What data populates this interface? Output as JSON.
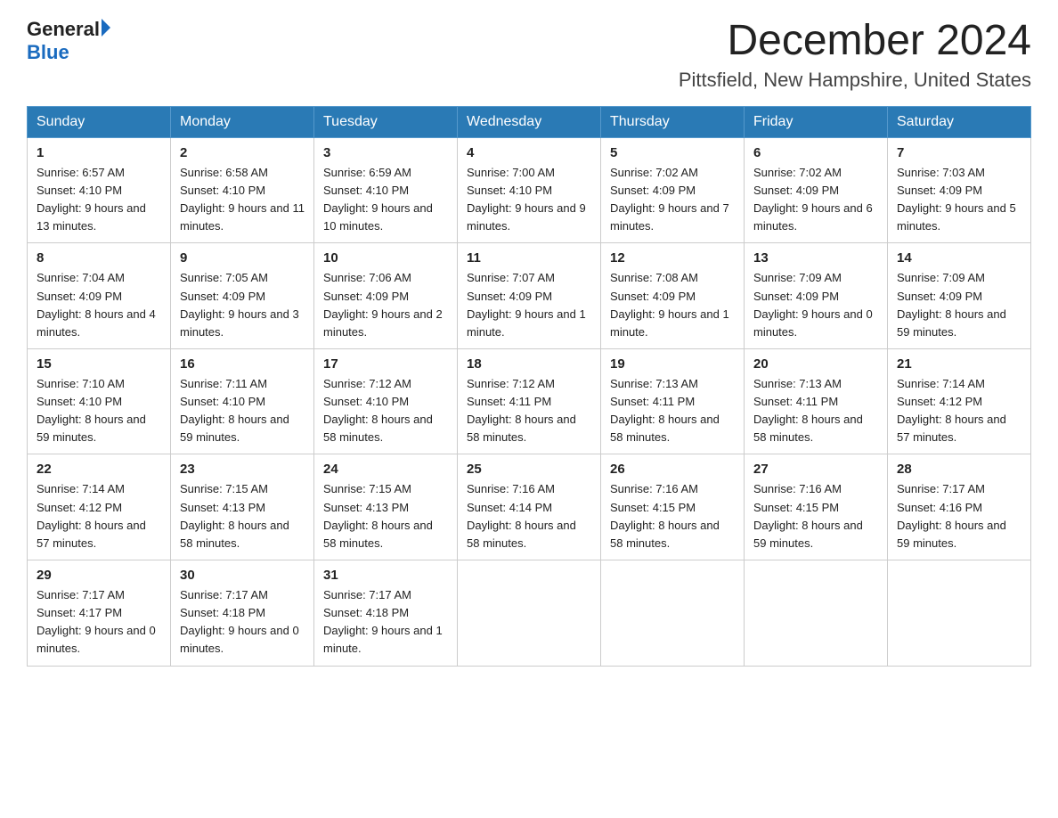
{
  "header": {
    "logo_general": "General",
    "logo_blue": "Blue",
    "month_title": "December 2024",
    "location": "Pittsfield, New Hampshire, United States"
  },
  "days_of_week": [
    "Sunday",
    "Monday",
    "Tuesday",
    "Wednesday",
    "Thursday",
    "Friday",
    "Saturday"
  ],
  "weeks": [
    [
      {
        "day": "1",
        "sunrise": "6:57 AM",
        "sunset": "4:10 PM",
        "daylight": "9 hours and 13 minutes."
      },
      {
        "day": "2",
        "sunrise": "6:58 AM",
        "sunset": "4:10 PM",
        "daylight": "9 hours and 11 minutes."
      },
      {
        "day": "3",
        "sunrise": "6:59 AM",
        "sunset": "4:10 PM",
        "daylight": "9 hours and 10 minutes."
      },
      {
        "day": "4",
        "sunrise": "7:00 AM",
        "sunset": "4:10 PM",
        "daylight": "9 hours and 9 minutes."
      },
      {
        "day": "5",
        "sunrise": "7:02 AM",
        "sunset": "4:09 PM",
        "daylight": "9 hours and 7 minutes."
      },
      {
        "day": "6",
        "sunrise": "7:02 AM",
        "sunset": "4:09 PM",
        "daylight": "9 hours and 6 minutes."
      },
      {
        "day": "7",
        "sunrise": "7:03 AM",
        "sunset": "4:09 PM",
        "daylight": "9 hours and 5 minutes."
      }
    ],
    [
      {
        "day": "8",
        "sunrise": "7:04 AM",
        "sunset": "4:09 PM",
        "daylight": "8 hours and 4 minutes."
      },
      {
        "day": "9",
        "sunrise": "7:05 AM",
        "sunset": "4:09 PM",
        "daylight": "9 hours and 3 minutes."
      },
      {
        "day": "10",
        "sunrise": "7:06 AM",
        "sunset": "4:09 PM",
        "daylight": "9 hours and 2 minutes."
      },
      {
        "day": "11",
        "sunrise": "7:07 AM",
        "sunset": "4:09 PM",
        "daylight": "9 hours and 1 minute."
      },
      {
        "day": "12",
        "sunrise": "7:08 AM",
        "sunset": "4:09 PM",
        "daylight": "9 hours and 1 minute."
      },
      {
        "day": "13",
        "sunrise": "7:09 AM",
        "sunset": "4:09 PM",
        "daylight": "9 hours and 0 minutes."
      },
      {
        "day": "14",
        "sunrise": "7:09 AM",
        "sunset": "4:09 PM",
        "daylight": "8 hours and 59 minutes."
      }
    ],
    [
      {
        "day": "15",
        "sunrise": "7:10 AM",
        "sunset": "4:10 PM",
        "daylight": "8 hours and 59 minutes."
      },
      {
        "day": "16",
        "sunrise": "7:11 AM",
        "sunset": "4:10 PM",
        "daylight": "8 hours and 59 minutes."
      },
      {
        "day": "17",
        "sunrise": "7:12 AM",
        "sunset": "4:10 PM",
        "daylight": "8 hours and 58 minutes."
      },
      {
        "day": "18",
        "sunrise": "7:12 AM",
        "sunset": "4:11 PM",
        "daylight": "8 hours and 58 minutes."
      },
      {
        "day": "19",
        "sunrise": "7:13 AM",
        "sunset": "4:11 PM",
        "daylight": "8 hours and 58 minutes."
      },
      {
        "day": "20",
        "sunrise": "7:13 AM",
        "sunset": "4:11 PM",
        "daylight": "8 hours and 58 minutes."
      },
      {
        "day": "21",
        "sunrise": "7:14 AM",
        "sunset": "4:12 PM",
        "daylight": "8 hours and 57 minutes."
      }
    ],
    [
      {
        "day": "22",
        "sunrise": "7:14 AM",
        "sunset": "4:12 PM",
        "daylight": "8 hours and 57 minutes."
      },
      {
        "day": "23",
        "sunrise": "7:15 AM",
        "sunset": "4:13 PM",
        "daylight": "8 hours and 58 minutes."
      },
      {
        "day": "24",
        "sunrise": "7:15 AM",
        "sunset": "4:13 PM",
        "daylight": "8 hours and 58 minutes."
      },
      {
        "day": "25",
        "sunrise": "7:16 AM",
        "sunset": "4:14 PM",
        "daylight": "8 hours and 58 minutes."
      },
      {
        "day": "26",
        "sunrise": "7:16 AM",
        "sunset": "4:15 PM",
        "daylight": "8 hours and 58 minutes."
      },
      {
        "day": "27",
        "sunrise": "7:16 AM",
        "sunset": "4:15 PM",
        "daylight": "8 hours and 59 minutes."
      },
      {
        "day": "28",
        "sunrise": "7:17 AM",
        "sunset": "4:16 PM",
        "daylight": "8 hours and 59 minutes."
      }
    ],
    [
      {
        "day": "29",
        "sunrise": "7:17 AM",
        "sunset": "4:17 PM",
        "daylight": "9 hours and 0 minutes."
      },
      {
        "day": "30",
        "sunrise": "7:17 AM",
        "sunset": "4:18 PM",
        "daylight": "9 hours and 0 minutes."
      },
      {
        "day": "31",
        "sunrise": "7:17 AM",
        "sunset": "4:18 PM",
        "daylight": "9 hours and 1 minute."
      },
      null,
      null,
      null,
      null
    ]
  ],
  "labels": {
    "sunrise": "Sunrise:",
    "sunset": "Sunset:",
    "daylight": "Daylight:"
  }
}
